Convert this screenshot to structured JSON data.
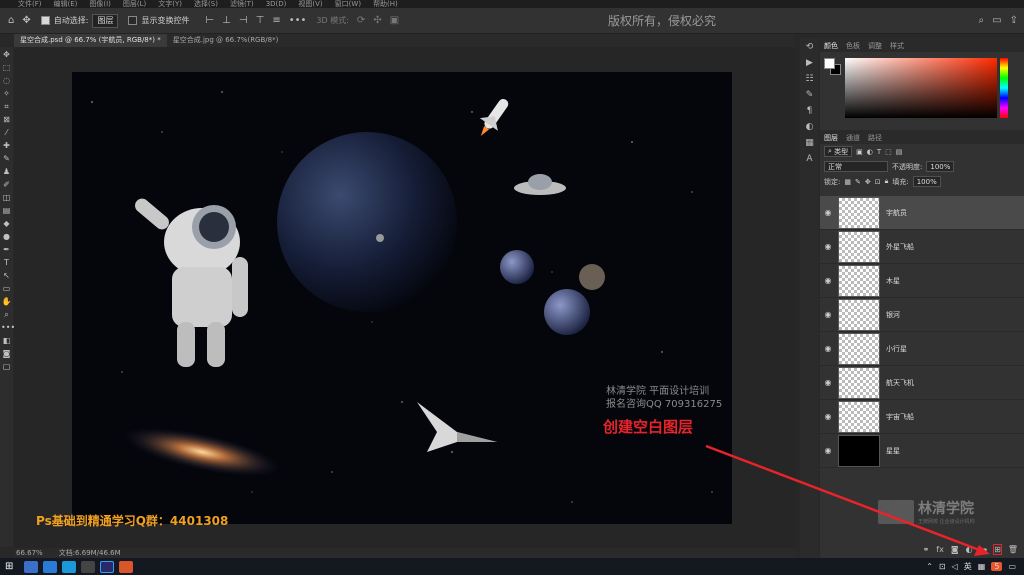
{
  "menubar": {
    "items": [
      "文件(F)",
      "编辑(E)",
      "图像(I)",
      "图层(L)",
      "文字(Y)",
      "选择(S)",
      "滤镜(T)",
      "3D(D)",
      "视图(V)",
      "窗口(W)",
      "帮助(H)"
    ]
  },
  "options": {
    "auto_select_label": "自动选择:",
    "auto_select_value": "图层",
    "show_transform_label": "显示变换控件",
    "mode_3d_label": "3D 模式:"
  },
  "watermark_top": "版权所有，侵权必究",
  "tabs": [
    {
      "label": "星空合成.psd @ 66.7% (宇航员, RGB/8*) *",
      "active": true
    },
    {
      "label": "星空合成.jpg @ 66.7%(RGB/8*)",
      "active": false
    }
  ],
  "status": {
    "zoom": "66.67%",
    "doc": "文档:6.69M/46.6M"
  },
  "color_panel": {
    "tabs": [
      "颜色",
      "色板",
      "调整",
      "样式"
    ]
  },
  "layers_panel": {
    "tabs": [
      "图层",
      "通道",
      "路径"
    ],
    "filter_label": "类型",
    "blend_mode": "正常",
    "opacity_label": "不透明度:",
    "opacity_value": "100%",
    "lock_label": "锁定:",
    "fill_label": "填充:",
    "fill_value": "100%",
    "layers": [
      {
        "name": "宇航员",
        "selected": true
      },
      {
        "name": "外星飞船",
        "selected": false
      },
      {
        "name": "木星",
        "selected": false
      },
      {
        "name": "银河",
        "selected": false
      },
      {
        "name": "小行星",
        "selected": false
      },
      {
        "name": "航天飞机",
        "selected": false
      },
      {
        "name": "宇宙飞船",
        "selected": false
      },
      {
        "name": "星星",
        "selected": false
      }
    ]
  },
  "overlays": {
    "info_line1": "林清学院  平面设计培训",
    "info_line2": "报名咨询QQ 709316275",
    "step_text": "创建空白图层",
    "group_text": "Ps基础到精通学习Q群：4401308",
    "logo_text": "林清学院",
    "logo_sub": "王牌网校 企业级设计机构"
  },
  "taskbar": {
    "ime": "英",
    "notify": "5"
  },
  "colors": {
    "accent_red": "#e8232a",
    "accent_orange": "#f0a020"
  }
}
